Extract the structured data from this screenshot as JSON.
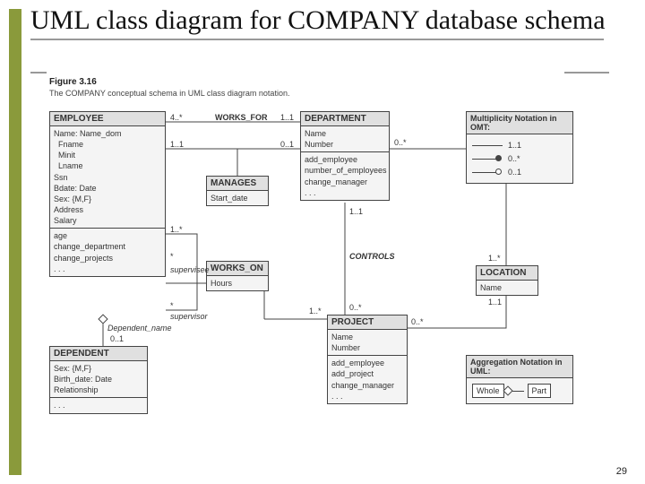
{
  "page": {
    "title": "UML class diagram for COMPANY database schema",
    "number": "29"
  },
  "figure": {
    "label": "Figure 3.16",
    "caption": "The COMPANY conceptual schema in UML class diagram notation."
  },
  "classes": {
    "employee": {
      "name": "EMPLOYEE",
      "attrs": "Name: Name_dom\n  Fname\n  Minit\n  Lname\nSsn\nBdate: Date\nSex: {M,F}\nAddress\nSalary",
      "ops": "age\nchange_department\nchange_projects\n. . ."
    },
    "department": {
      "name": "DEPARTMENT",
      "attrs": "Name\nNumber",
      "ops": "add_employee\nnumber_of_employees\nchange_manager\n. . ."
    },
    "manages": {
      "name": "MANAGES",
      "attrs": "Start_date"
    },
    "works_on": {
      "name": "WORKS_ON",
      "attrs": "Hours"
    },
    "project": {
      "name": "PROJECT",
      "attrs": "Name\nNumber",
      "ops": "add_employee\nadd_project\nchange_manager\n. . ."
    },
    "location": {
      "name": "LOCATION",
      "attrs": "Name"
    },
    "dependent": {
      "name": "DEPENDENT",
      "attrs": "Sex: {M,F}\nBirth_date: Date\nRelationship",
      "ops": ". . ."
    }
  },
  "labels": {
    "works_for": "WORKS_FOR",
    "controls": "CONTROLS",
    "supervisee": "supervisee",
    "supervisor": "supervisor",
    "dependent_name": "Dependent_name",
    "m_4s": "4..*",
    "m_11": "1..1",
    "m_11b": "1..1",
    "m_01": "0..1",
    "m_1s": "1..*",
    "m_1sb": "1..*",
    "m_star": "*",
    "m_starb": "*",
    "m_0s": "0..*",
    "m_0sb": "0..*",
    "m_1sc": "1..*",
    "m_01b": "0..1",
    "m_11c": "1..1"
  },
  "legend_mult": {
    "title": "Multiplicity Notation in OMT:",
    "a": "1..1",
    "b": "0..*",
    "c": "0..1"
  },
  "legend_agg": {
    "title": "Aggregation Notation in UML:",
    "whole": "Whole",
    "part": "Part"
  }
}
